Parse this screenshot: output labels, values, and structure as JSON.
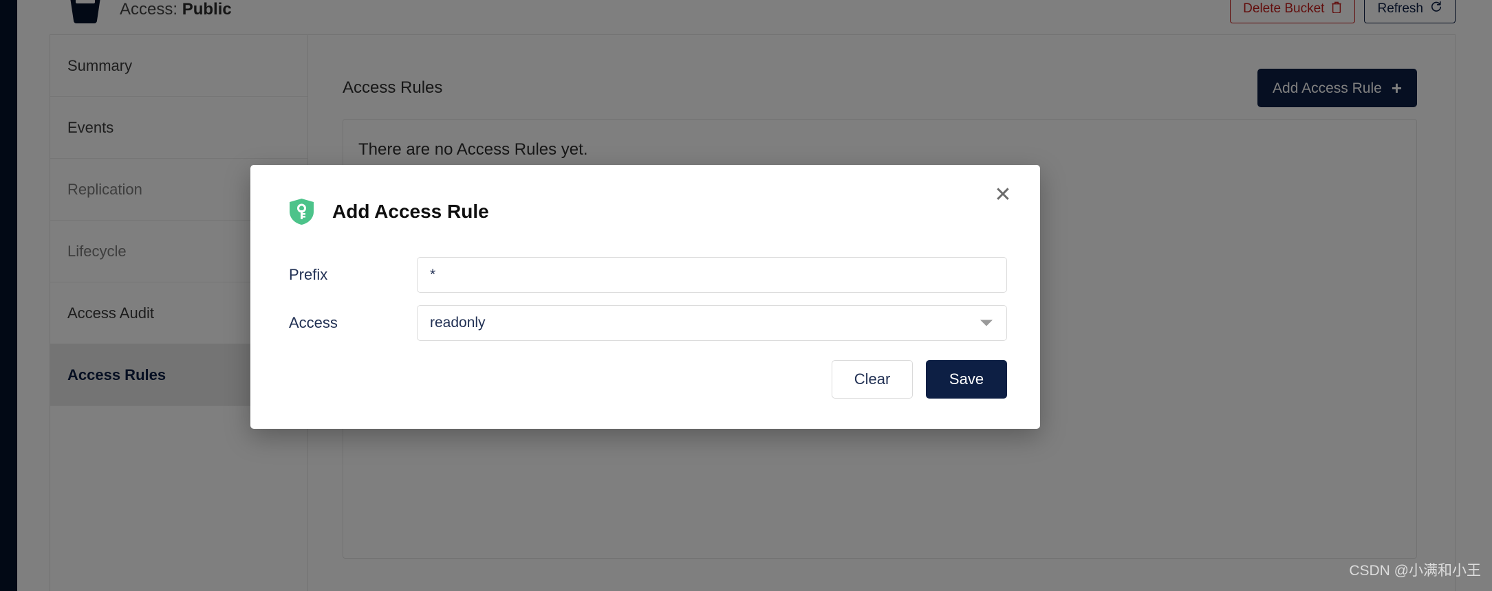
{
  "header": {
    "bucket_icon": "bucket-icon",
    "access_prefix": "Access:",
    "access_value": "Public",
    "delete_bucket_label": "Delete Bucket",
    "delete_bucket_icon": "trash-icon",
    "refresh_label": "Refresh",
    "refresh_icon": "refresh-icon"
  },
  "sidebar": {
    "items": [
      {
        "label": "Summary",
        "active": false
      },
      {
        "label": "Events",
        "active": false
      },
      {
        "label": "Replication",
        "active": false
      },
      {
        "label": "Lifecycle",
        "active": false
      },
      {
        "label": "Access Audit",
        "active": false
      },
      {
        "label": "Access Rules",
        "active": true
      }
    ]
  },
  "main": {
    "title": "Access Rules",
    "add_rule_label": "Add Access Rule",
    "add_rule_icon": "plus-icon",
    "empty_message": "There are no Access Rules yet."
  },
  "modal": {
    "title": "Add Access Rule",
    "icon": "shield-key-icon",
    "close_icon": "close-icon",
    "fields": [
      {
        "label": "Prefix",
        "value": "*",
        "placeholder": "",
        "type": "text"
      },
      {
        "label": "Access",
        "value": "readonly",
        "placeholder": "",
        "type": "select"
      }
    ],
    "clear_label": "Clear",
    "save_label": "Save"
  },
  "watermark": "CSDN @小满和小王",
  "colors": {
    "navy": "#0d1f44",
    "rail": "#05122b",
    "danger": "#c51b18",
    "shield_green": "#4cc38a",
    "overlay": "rgba(0,0,0,0.5)"
  }
}
